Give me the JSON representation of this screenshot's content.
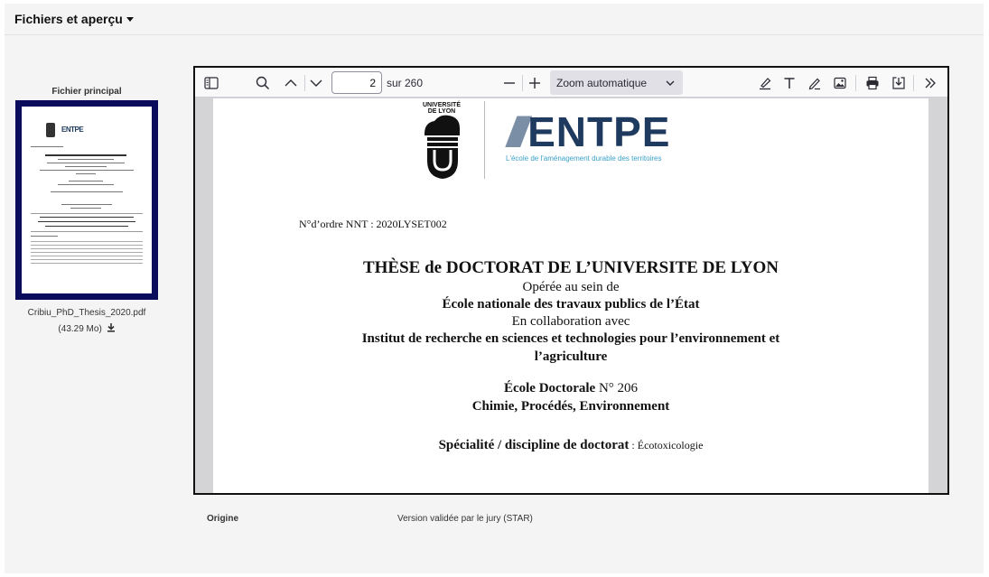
{
  "panel": {
    "title": "Fichiers et aperçu"
  },
  "file": {
    "heading": "Fichier principal",
    "name": "Cribiu_PhD_Thesis_2020.pdf",
    "size": "(43.29 Mo)"
  },
  "viewer": {
    "current_page": "2",
    "total_pages": "sur 260",
    "zoom": "Zoom automatique"
  },
  "document": {
    "univ_logo_text": "UNIVERSITÉ DE LYON",
    "entpe_logo": "ENTPE",
    "entpe_tagline": "L'école de l'aménagement durable des territoires",
    "nnt": "N°d’ordre NNT : 2020LYSET002",
    "title": "THÈSE de DOCTORAT DE L’UNIVERSITE DE LYON",
    "operated": "Opérée au sein de",
    "school": "École nationale des travaux publics de l’État",
    "collab": "En collaboration avec",
    "institute_1": "Institut de recherche en sciences et technologies pour l’environnement et",
    "institute_2": "l’agriculture",
    "doctoral_label": "École Doctorale",
    "doctoral_num": " N° 206",
    "doctoral_name": "Chimie, Procédés, Environnement",
    "specialty_label": "Spécialité / discipline de doctorat",
    "specialty_value": " : Écotoxicologie"
  },
  "metadata": {
    "origin_label": "Origine",
    "origin_value": "Version validée par le jury (STAR)"
  }
}
